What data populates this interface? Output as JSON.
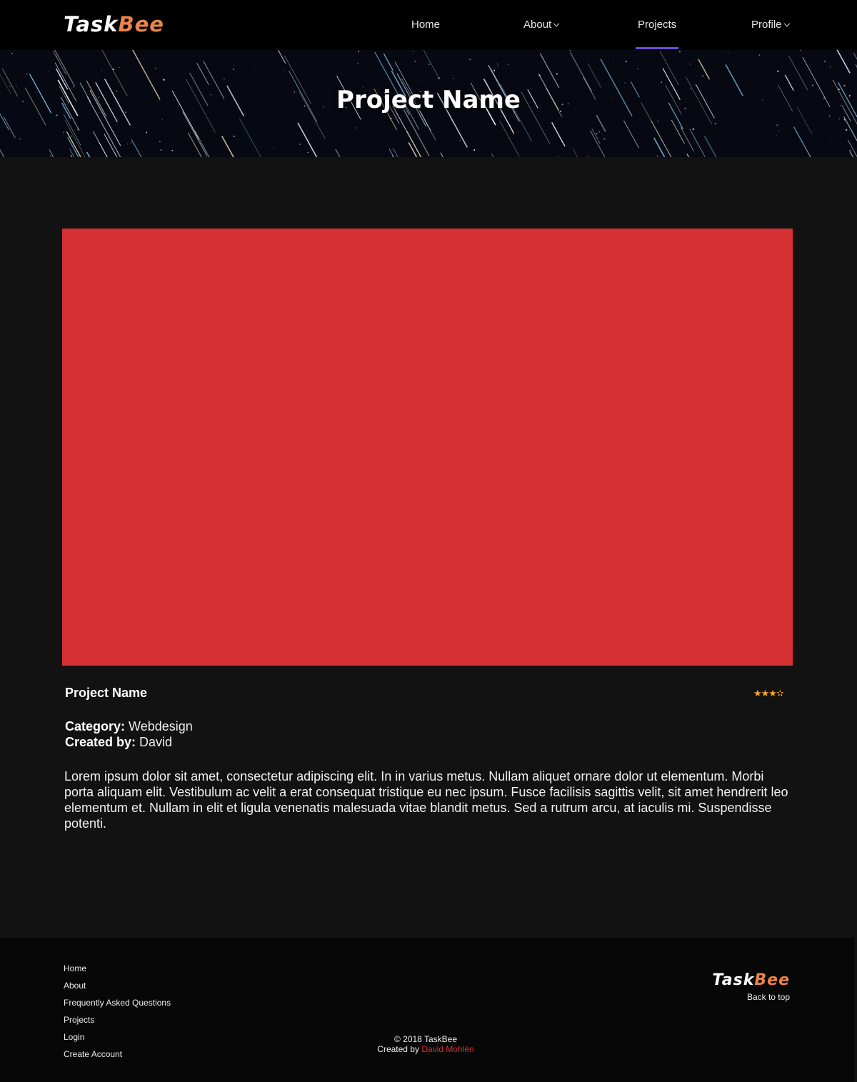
{
  "brand": {
    "part1": "Task",
    "part2": "Bee",
    "accent_color": "#e8844a"
  },
  "nav": {
    "home": "Home",
    "about": "About",
    "projects": "Projects",
    "profile": "Profile",
    "active": "Projects",
    "active_color": "#6a4fd8"
  },
  "hero": {
    "title": "Project Name"
  },
  "project": {
    "image_color": "#d53032",
    "name": "Project Name",
    "rating": 3.5,
    "rating_display": "★★★✫",
    "category_label": "Category:",
    "category_value": "Webdesign",
    "created_label": "Created by:",
    "created_value": "David",
    "description": "Lorem ipsum dolor sit amet, consectetur adipiscing elit. In in varius metus. Nullam aliquet ornare dolor ut elementum. Morbi porta aliquam elit. Vestibulum ac velit a erat consequat tristique eu nec ipsum. Fusce facilisis sagittis velit, sit amet hendrerit leo elementum et. Nullam in elit et ligula venenatis malesuada vitae blandit metus. Sed a rutrum arcu, at iaculis mi. Suspendisse potenti."
  },
  "footer": {
    "links": [
      "Home",
      "About",
      "Frequently Asked Questions",
      "Projects",
      "Login",
      "Create Account"
    ],
    "copyright": "© 2018 TaskBee",
    "created_by": "Created by ",
    "author": "David Mohlén",
    "back_to_top": "Back to top"
  }
}
